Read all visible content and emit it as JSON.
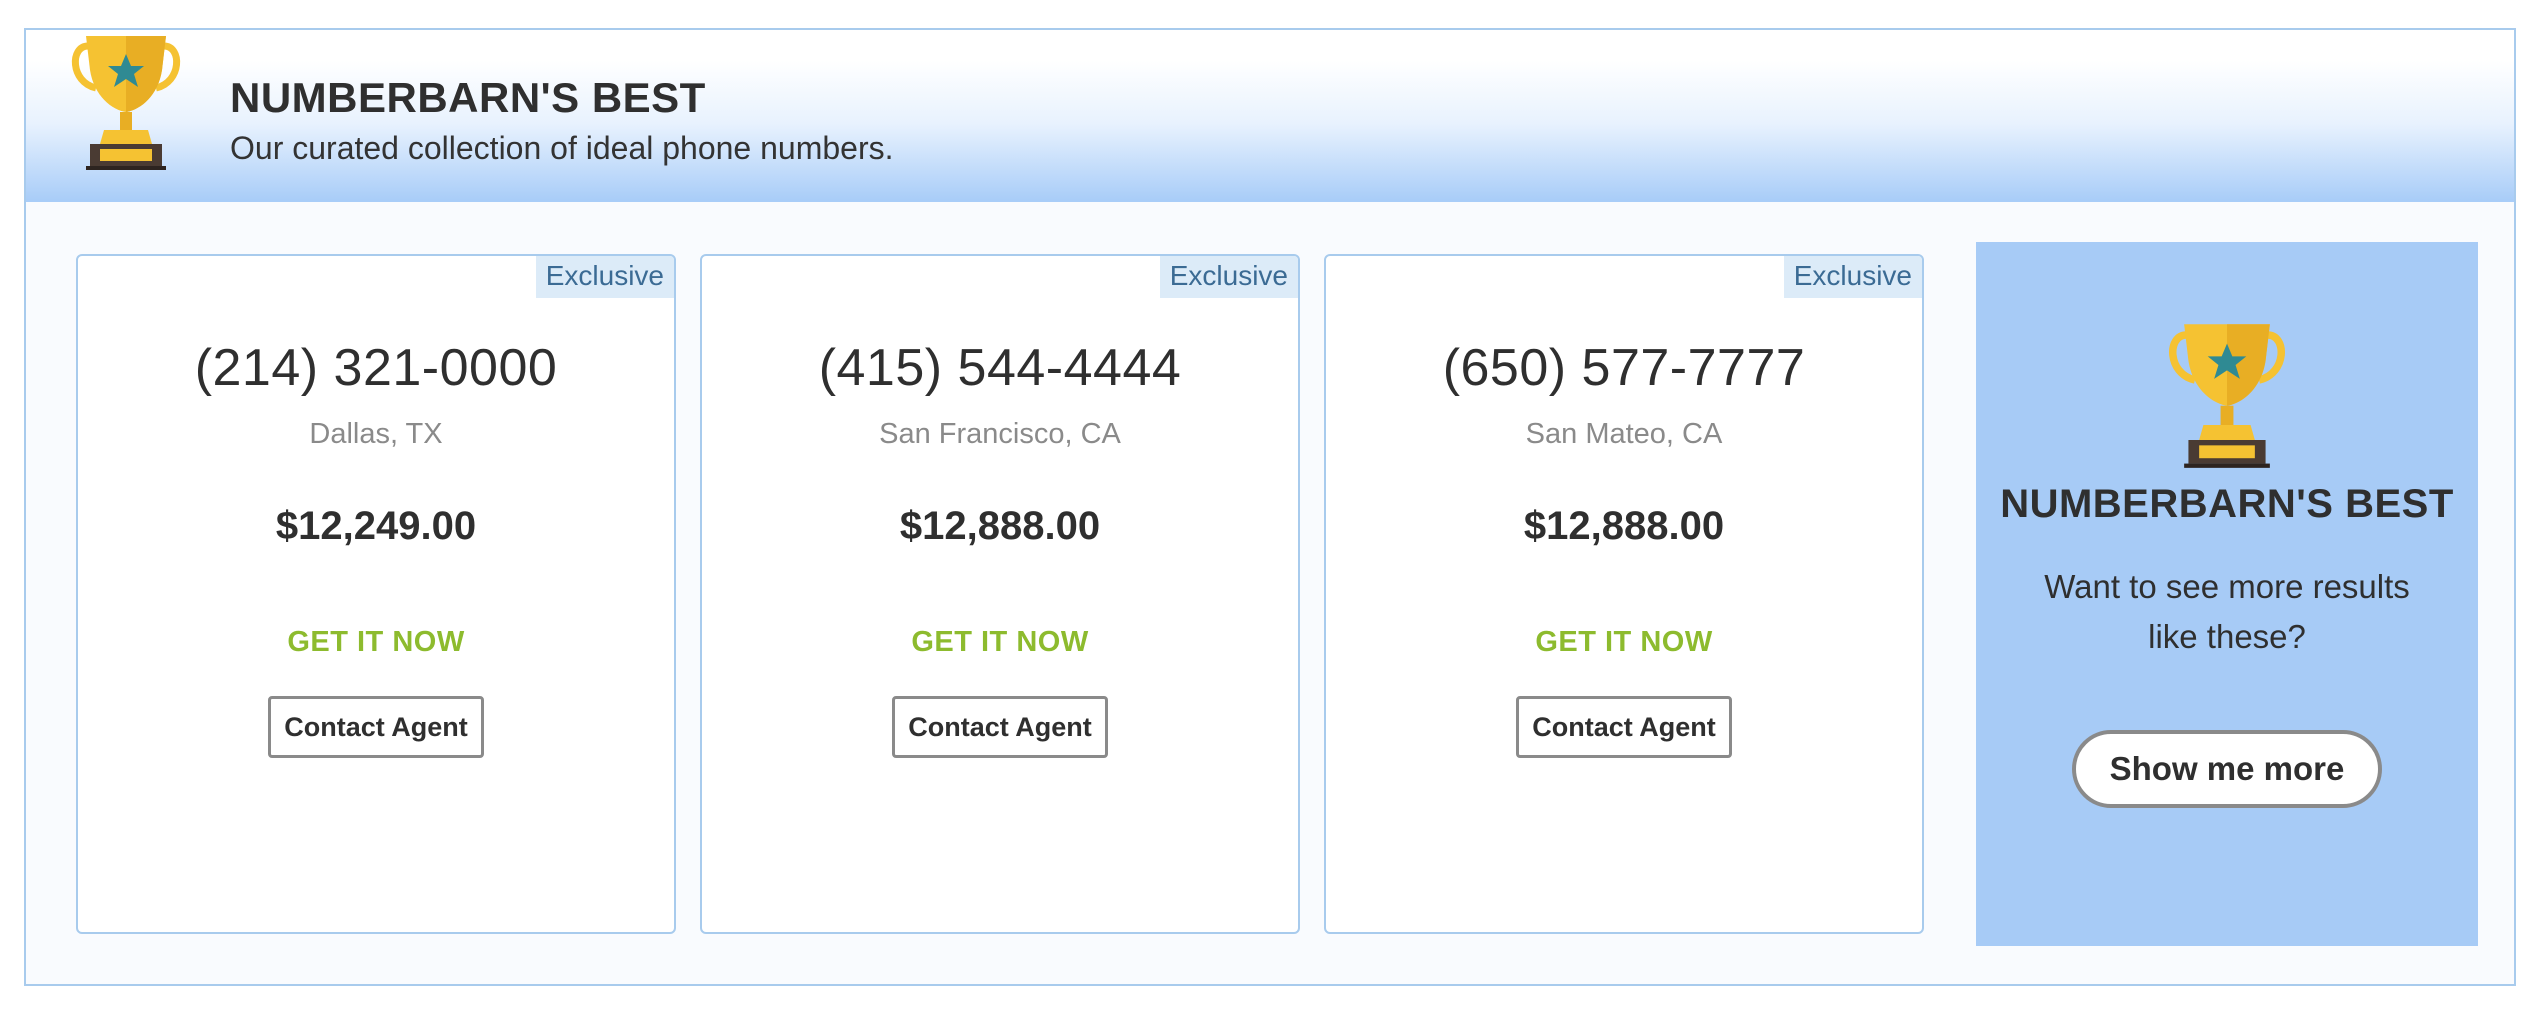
{
  "header": {
    "title": "NUMBERBARN'S BEST",
    "subtitle": "Our curated collection of ideal phone numbers."
  },
  "listings": [
    {
      "badge": "Exclusive",
      "phone": "(214) 321-0000",
      "location": "Dallas, TX",
      "price": "$12,249.00",
      "get_label": "GET IT NOW",
      "contact_label": "Contact Agent"
    },
    {
      "badge": "Exclusive",
      "phone": "(415) 544-4444",
      "location": "San Francisco, CA",
      "price": "$12,888.00",
      "get_label": "GET IT NOW",
      "contact_label": "Contact Agent"
    },
    {
      "badge": "Exclusive",
      "phone": "(650) 577-7777",
      "location": "San Mateo, CA",
      "price": "$12,888.00",
      "get_label": "GET IT NOW",
      "contact_label": "Contact Agent"
    }
  ],
  "promo": {
    "title": "NUMBERBARN'S BEST",
    "text": "Want to see more results like these?",
    "button_label": "Show me more"
  },
  "icons": {
    "header": "trophy-icon",
    "promo": "trophy-icon"
  },
  "colors": {
    "accent_green": "#8dbb2e",
    "border_blue": "#a8cbed",
    "promo_bg": "#a7cbf6",
    "badge_bg": "#dcebf8",
    "trophy_gold": "#f5c232",
    "trophy_star": "#2f8a93"
  }
}
